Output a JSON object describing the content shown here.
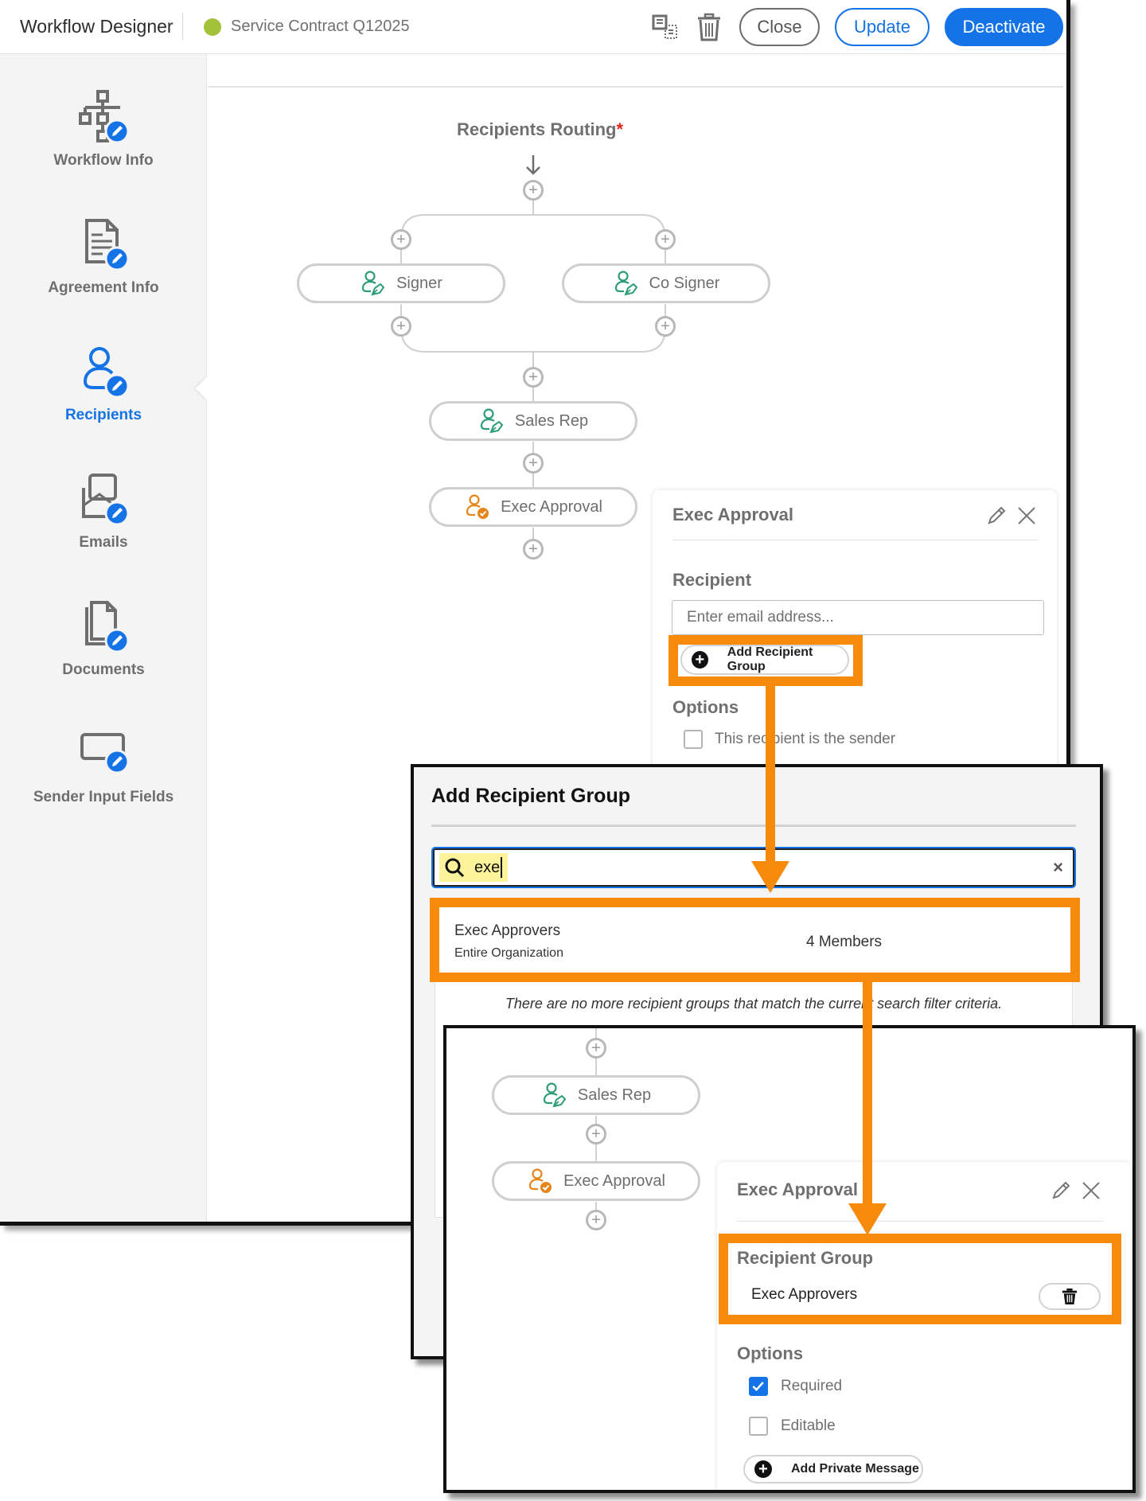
{
  "header": {
    "app_title": "Workflow Designer",
    "document_name": "Service Contract Q12025",
    "status_color": "#a3c23a",
    "icons": [
      "copy-icon",
      "trash-icon"
    ],
    "close_label": "Close",
    "update_label": "Update",
    "deactivate_label": "Deactivate"
  },
  "sidebar": {
    "active": "Recipients",
    "items": [
      {
        "label": "Workflow Info",
        "icon": "workflow-icon"
      },
      {
        "label": "Agreement Info",
        "icon": "document-icon"
      },
      {
        "label": "Recipients",
        "icon": "person-icon"
      },
      {
        "label": "Emails",
        "icon": "email-icon"
      },
      {
        "label": "Documents",
        "icon": "documents-icon"
      },
      {
        "label": "Sender Input Fields",
        "icon": "input-field-icon"
      }
    ]
  },
  "routing": {
    "title": "Recipients Routing",
    "required_marker": "*",
    "nodes": [
      {
        "label": "Signer",
        "role": "signer"
      },
      {
        "label": "Co Signer",
        "role": "signer"
      },
      {
        "label": "Sales Rep",
        "role": "signer"
      },
      {
        "label": "Exec Approval",
        "role": "approver"
      }
    ],
    "signer_color": "#2d9d78",
    "approver_color": "#e68619"
  },
  "recipient_panel": {
    "title": "Exec Approval",
    "recipient_label": "Recipient",
    "email_placeholder": "Enter email address...",
    "add_group_label": "Add Recipient Group",
    "options_label": "Options",
    "sender_option_label": "This recipient is the sender",
    "sender_option_checked": false
  },
  "add_group_dialog": {
    "title": "Add Recipient Group",
    "search_value": "exe",
    "results": [
      {
        "name": "Exec Approvers",
        "scope": "Entire Organization",
        "members": "4 Members"
      }
    ],
    "no_more_message": "There are no more recipient groups that match the current search filter criteria."
  },
  "result_view": {
    "nodes": [
      {
        "label": "Sales Rep",
        "role": "signer"
      },
      {
        "label": "Exec Approval",
        "role": "approver"
      }
    ],
    "panel": {
      "title": "Exec Approval",
      "group_label": "Recipient Group",
      "group_name": "Exec Approvers",
      "options_label": "Options",
      "options": [
        {
          "label": "Required",
          "checked": true
        },
        {
          "label": "Editable",
          "checked": false
        }
      ],
      "add_message_label": "Add Private Message"
    }
  },
  "callout_color": "#f58a0b",
  "accent_color": "#1473e6"
}
